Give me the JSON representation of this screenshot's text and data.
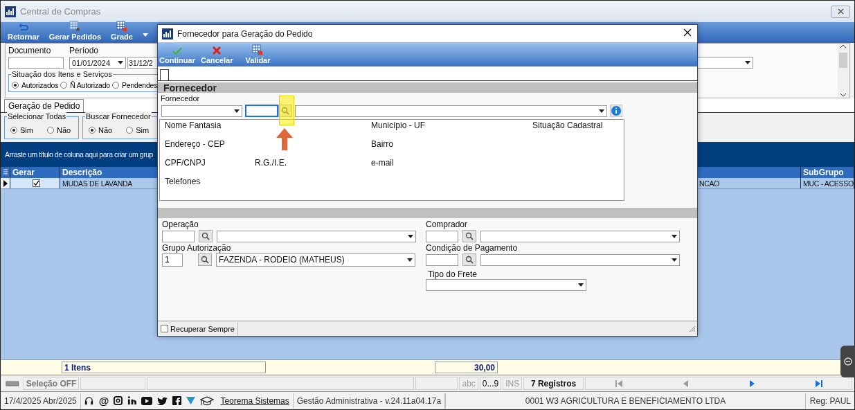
{
  "window": {
    "title": "Central de Compras"
  },
  "toolbar": [
    {
      "label": "Retornar"
    },
    {
      "label": "Gerar Pedidos"
    },
    {
      "label": "Grade"
    }
  ],
  "filters": {
    "document": {
      "label": "Documento"
    },
    "period": {
      "label": "Período",
      "start": "01/01/2024",
      "end": "31/12/2"
    },
    "situation": {
      "title": "Situação dos Itens e Serviços",
      "options": [
        {
          "label": "Autorizados",
          "selected": true
        },
        {
          "label": "Ñ Autorizado",
          "selected": false
        },
        {
          "label": "Pendendes",
          "selected": false
        }
      ]
    }
  },
  "tabs": [
    {
      "label": "Geração de Pedido",
      "selected": true
    }
  ],
  "option_groups": [
    {
      "title": "Selecionar Todas",
      "options": [
        {
          "label": "Sim",
          "selected": true
        },
        {
          "label": "Não",
          "selected": false
        }
      ]
    },
    {
      "title": "Buscar Fornecedor",
      "options": [
        {
          "label": "Não",
          "selected": true
        },
        {
          "label": "Sim",
          "selected": false
        }
      ]
    }
  ],
  "group_panel": {
    "hint": "Arraste um título de coluna aqui para criar um grup"
  },
  "grid": {
    "columns": {
      "gerar": "Gerar",
      "descricao": "Descrição",
      "subgrupo": "SubGrupo"
    },
    "rows": [
      {
        "current": true,
        "gerar": true,
        "descricao": "MUDAS DE LAVANDA",
        "column_3": "NCAO",
        "subgrupo": "MUC - ACESSO"
      }
    ]
  },
  "totals": {
    "items": "1 Itens",
    "value": "30,00"
  },
  "status_bar": {
    "selection": "Seleção OFF",
    "indicators": [
      {
        "label": "abc",
        "active": false
      },
      {
        "label": "0...9",
        "active": true
      },
      {
        "label": "INS",
        "active": false
      }
    ],
    "records": "7 Registros",
    "nav": [
      {
        "kind": "first",
        "disabled": true
      },
      {
        "kind": "prev",
        "disabled": true
      },
      {
        "kind": "next",
        "disabled": false
      },
      {
        "kind": "last",
        "disabled": false
      }
    ]
  },
  "footer": {
    "date": "17/4/2025 Abr/2025",
    "at_sign": "@",
    "link": "Teorema Sistemas",
    "version": "Gestão Administrativa - v.24.11a04.17a",
    "company": "0001 W3 AGRICULTURA E BENEFICIAMENTO LTDA",
    "user": "Reg: PAUL"
  },
  "dialog": {
    "title": "Fornecedor para Geração do Pedido",
    "toolbar": [
      {
        "label": "Continuar"
      },
      {
        "label": "Cancelar"
      },
      {
        "label": "Validar"
      }
    ],
    "section": "Fornecedor",
    "supplier": {
      "label": "Fornecedor"
    },
    "details": {
      "nome_fantasia": "Nome Fantasia",
      "municipio_uf": "Município - UF",
      "situacao_cadastral": "Situação Cadastral",
      "endereco_cep": "Endereço - CEP",
      "bairro": "Bairro",
      "cpf_cnpj": "CPF/CNPJ",
      "rg_ie": "R.G./I.E.",
      "email": "e-mail",
      "telefones": "Telefones"
    },
    "operation": {
      "label": "Operação"
    },
    "buyer": {
      "label": "Comprador"
    },
    "auth_group": {
      "label": "Grupo Autorização",
      "code": "1",
      "value": "FAZENDA - RODEIO (MATHEUS)"
    },
    "payment": {
      "label": "Condição de Pagamento"
    },
    "freight": {
      "label": "Tipo do Frete"
    },
    "recover_always": {
      "label": "Recuperar Sempre",
      "checked": false
    }
  }
}
